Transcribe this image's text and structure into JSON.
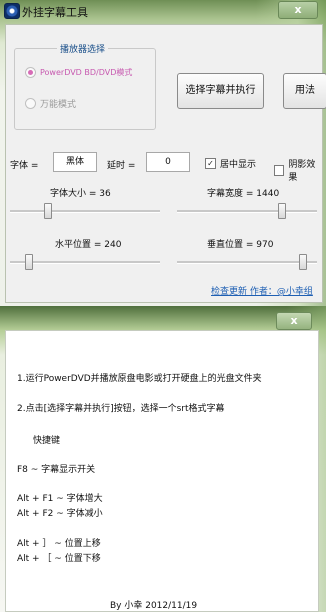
{
  "window_top": {
    "title": "外挂字幕工具",
    "close_label": "x",
    "player_group": {
      "title": "播放器选择",
      "options": [
        {
          "label": "PowerDVD BD/DVD模式",
          "selected": true
        },
        {
          "label": "万能模式",
          "selected": false
        }
      ]
    },
    "buttons": {
      "execute": "选择字幕并执行",
      "help": "用法"
    },
    "font": {
      "label": "字体 =",
      "value": "黑体"
    },
    "delay": {
      "label": "延时 =",
      "value": "0"
    },
    "checkboxes": [
      {
        "label": "居中显示",
        "checked": true
      },
      {
        "label": "阴影效果",
        "checked": false
      }
    ],
    "sliders": [
      {
        "label": "字体大小 = 36",
        "value": 36,
        "min": 8,
        "max": 120
      },
      {
        "label": "字幕宽度 = 1440",
        "value": 1440,
        "min": 0,
        "max": 1920
      },
      {
        "label": "水平位置 = 240",
        "value": 240,
        "min": 0,
        "max": 1920
      },
      {
        "label": "垂直位置 = 970",
        "value": 970,
        "min": 0,
        "max": 1080
      }
    ],
    "footer_link": "检查更新 作者：@小幸组"
  },
  "window_bottom": {
    "close_label": "x",
    "lines": [
      "1.运行PowerDVD并播放原盘电影或打开硬盘上的光盘文件夹",
      "2.点击[选择字幕并执行]按钮，选择一个srt格式字幕",
      "快捷键",
      "F8  ~   字幕显示开关",
      "Alt + F1 ~ 字体增大",
      "Alt + F2 ~ 字体减小",
      "Alt + ］ ~ 位置上移",
      "Alt + ［ ~ 位置下移",
      "By 小幸   2012/11/19"
    ]
  }
}
